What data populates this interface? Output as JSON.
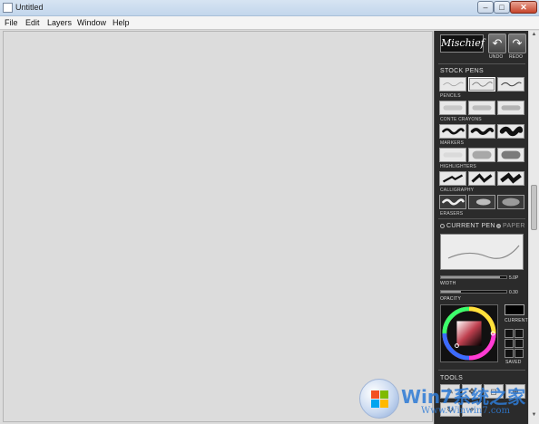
{
  "window": {
    "title": "Untitled",
    "controls": {
      "minimize": "–",
      "maximize": "□",
      "close": "✕"
    }
  },
  "menubar": {
    "items": [
      "File",
      "Edit",
      "Layers",
      "Window",
      "Help"
    ]
  },
  "panel": {
    "logo": "Mischief",
    "undo_label": "UNDO",
    "redo_label": "REDO",
    "undo_icon": "↶",
    "redo_icon": "↷",
    "stock_pens_title": "STOCK PENS",
    "categories": [
      "PENCILS",
      "CONTE CRAYONS",
      "MARKERS",
      "HIGHLIGHTERS",
      "CALLIGRAPHY",
      "ERASERS"
    ],
    "current_pen_label": "CURRENT PEN",
    "paper_label": "PAPER",
    "width_label": "WIDTH",
    "width_value": "5.0P",
    "width_level": 0.9,
    "opacity_label": "OPACITY",
    "opacity_value": "0.30",
    "opacity_level": 0.3,
    "current_color_label": "CURRENT",
    "saved_label": "SAVED",
    "tools_title": "TOOLS",
    "current_color": "#000000"
  },
  "watermark": {
    "text": "Win7系统之家",
    "url": "Www.Winwin7.com"
  },
  "colors": {
    "panel_bg": "#2b2b2b",
    "canvas_bg": "#dcdcdc",
    "accent": "#2e7bd6"
  }
}
